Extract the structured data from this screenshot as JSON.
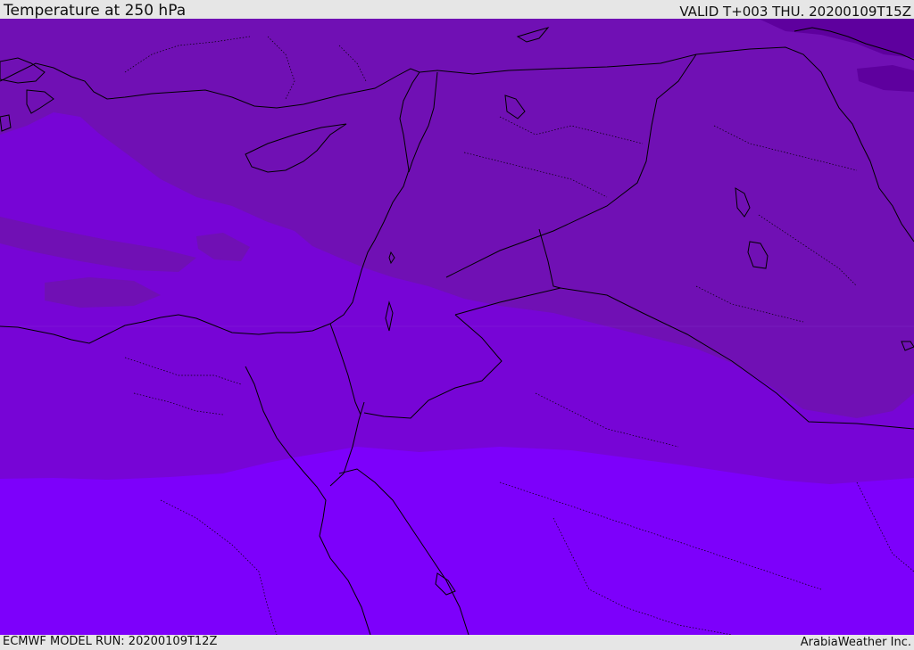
{
  "header": {
    "title": "Temperature at 250 hPa",
    "valid": "VALID T+003 THU. 20200109T15Z"
  },
  "footer": {
    "model_run": "ECMWF MODEL RUN: 20200109T12Z",
    "credit": "ArabiaWeather Inc."
  },
  "map": {
    "colors": {
      "band_coldest": "#5e009e",
      "band_cold": "#7010b4",
      "band_mid": "#7705d6",
      "band_warm": "#7d00fb",
      "coast": "#000000",
      "border": "#000000"
    }
  }
}
